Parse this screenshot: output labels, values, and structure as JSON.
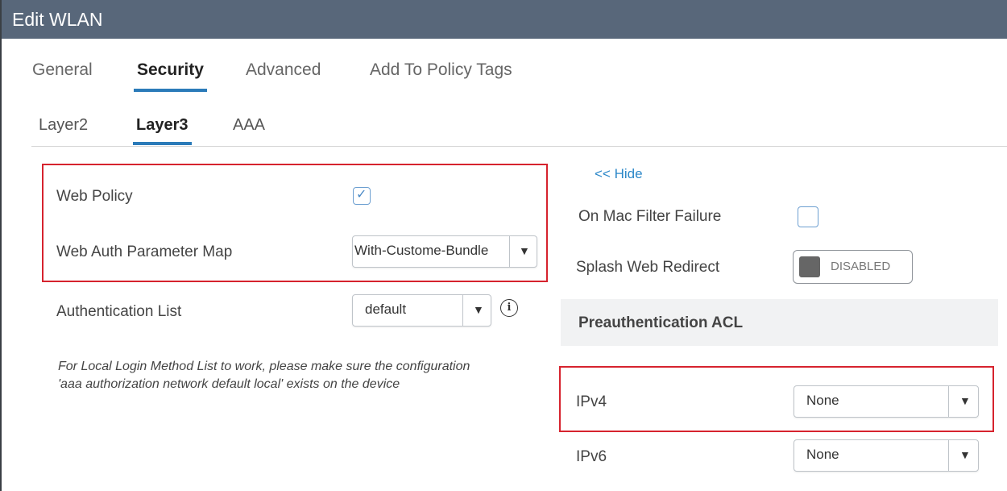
{
  "window": {
    "title": "Edit WLAN"
  },
  "tabs": [
    {
      "label": "General",
      "active": false
    },
    {
      "label": "Security",
      "active": true
    },
    {
      "label": "Advanced",
      "active": false
    },
    {
      "label": "Add To Policy Tags",
      "active": false
    }
  ],
  "subtabs": [
    {
      "label": "Layer2",
      "active": false
    },
    {
      "label": "Layer3",
      "active": true
    },
    {
      "label": "AAA",
      "active": false
    }
  ],
  "left": {
    "web_policy": {
      "label": "Web Policy",
      "checked": true
    },
    "web_auth_param_map": {
      "label": "Web Auth Parameter Map",
      "value": "With-Custome-Bundle"
    },
    "authentication_list": {
      "label": "Authentication List",
      "value": "default",
      "info_icon": "info-icon"
    },
    "note": "For Local Login Method List to work, please make sure the configuration 'aaa authorization network default local' exists on the device"
  },
  "right": {
    "hide_link": "<< Hide",
    "mac_filter_failure": {
      "label": "On Mac Filter Failure",
      "checked": false
    },
    "splash_web_redirect": {
      "label": "Splash Web Redirect",
      "state": "DISABLED"
    },
    "preauth_section": "Preauthentication ACL",
    "ipv4": {
      "label": "IPv4",
      "value": "None"
    },
    "ipv6": {
      "label": "IPv6",
      "value": "None"
    }
  },
  "colors": {
    "titlebar": "#58677a",
    "accent": "#2b7bb9",
    "highlight": "#d6232e",
    "link": "#2b87c8"
  }
}
